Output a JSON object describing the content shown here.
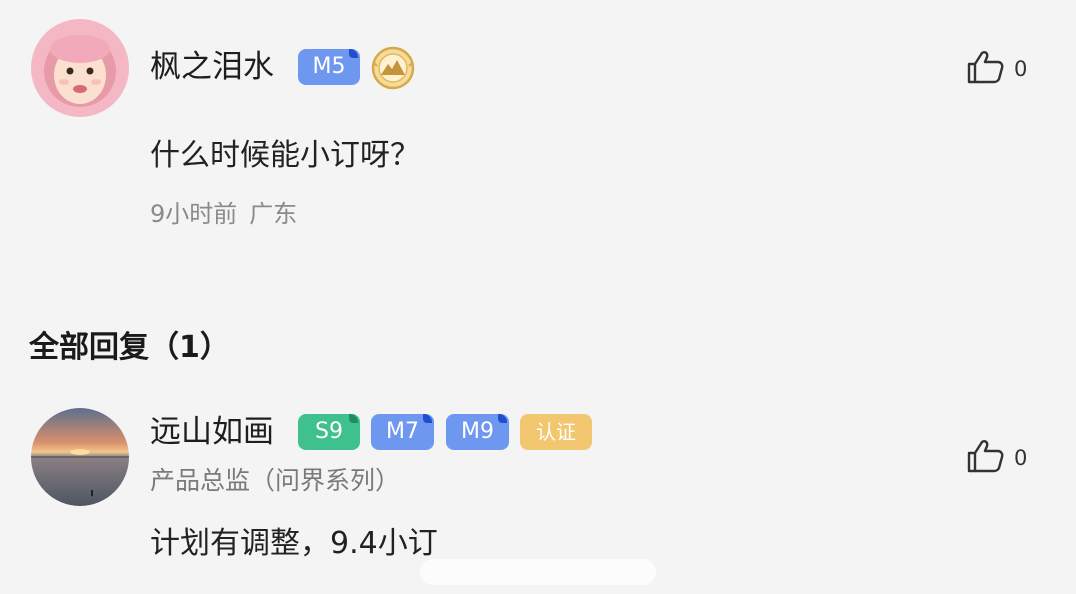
{
  "comment": {
    "username": "枫之泪水",
    "badges": {
      "level": "M5"
    },
    "medal_icon": "mountain-medal-icon",
    "text": "什么时候能小订呀？",
    "time": "9小时前",
    "location": "广东",
    "like_icon": "thumbs-up-icon",
    "likes": "0"
  },
  "replies_section": {
    "title": "全部回复（1）"
  },
  "reply": {
    "username": "远山如画",
    "badges": {
      "s": "S9",
      "m1": "M7",
      "m2": "M9",
      "verified": "认证"
    },
    "role": "产品总监（问界系列）",
    "text": "计划有调整，9.4小订",
    "like_icon": "thumbs-up-icon",
    "likes": "0"
  },
  "colors": {
    "background": "#f4f4f5",
    "badge_m": "#6e98f0",
    "badge_s": "#3ec18c",
    "badge_verified": "#f2c76f",
    "meta_text": "#8a8a8a"
  }
}
